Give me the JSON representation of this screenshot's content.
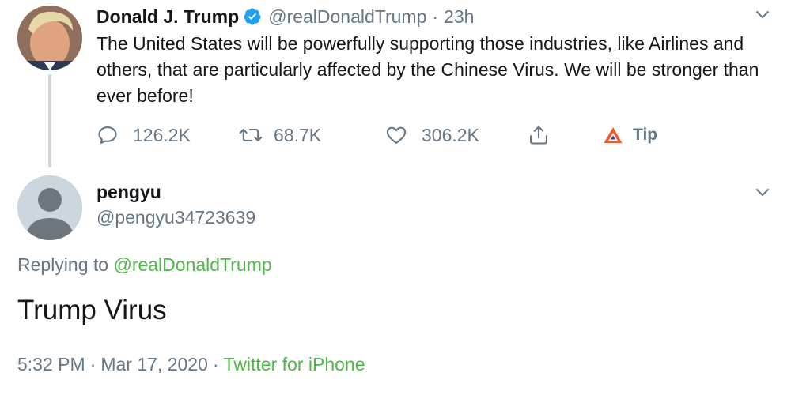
{
  "parent_tweet": {
    "display_name": "Donald J. Trump",
    "handle": "@realDonaldTrump",
    "separator": "·",
    "time": "23h",
    "text": "The United States will be powerfully supporting those industries, like Airlines and others, that are particularly affected by the Chinese Virus. We will be stronger than ever before!",
    "actions": {
      "replies": "126.2K",
      "retweets": "68.7K",
      "likes": "306.2K",
      "tip_label": "Tip"
    },
    "icons": [
      "verified-badge-icon",
      "chevron-down-icon",
      "reply-icon",
      "retweet-icon",
      "like-icon",
      "share-icon",
      "brave-tip-icon"
    ],
    "verified_color": "#1da1f2"
  },
  "reply_tweet": {
    "display_name": "pengyu",
    "handle": "@pengyu34723639",
    "replying_to_label": "Replying to",
    "replying_to_handle": "@realDonaldTrump",
    "text": "Trump Virus",
    "time": "5:32 PM",
    "separator": "·",
    "date": "Mar 17, 2020",
    "source": "Twitter for iPhone"
  },
  "colors": {
    "primary_text": "#14171a",
    "secondary_text": "#657786",
    "link_green": "#4fb648",
    "thread_line": "#ccd6dd",
    "brave_orange": "#f15a2b"
  }
}
